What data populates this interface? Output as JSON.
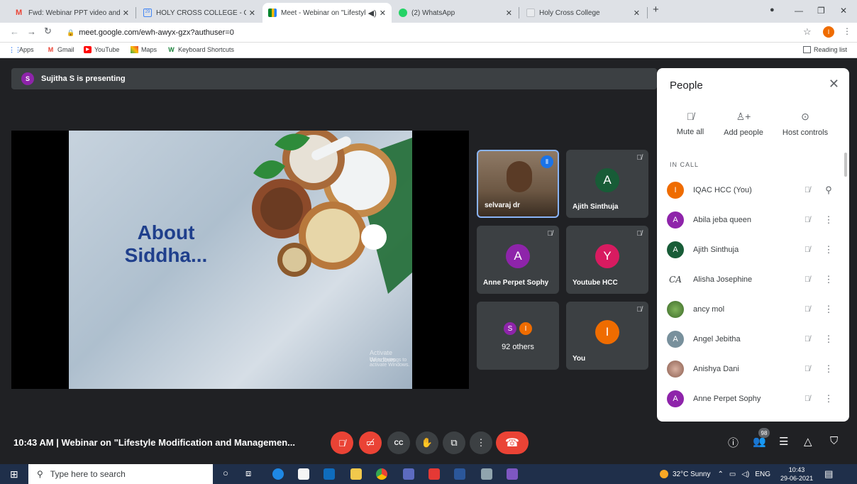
{
  "browser": {
    "tabs": [
      {
        "title": "Fwd: Webinar PPT video and Pra",
        "icon": "gmail-icon",
        "color": "#ea4335"
      },
      {
        "title": "HOLY CROSS COLLEGE - Calenda",
        "icon": "calendar-icon",
        "color": "#4285f4"
      },
      {
        "title": "Meet - Webinar on \"Lifestyle",
        "icon": "meet-icon",
        "color": "#00832d"
      },
      {
        "title": "(2) WhatsApp",
        "icon": "whatsapp-icon",
        "color": "#25d366"
      },
      {
        "title": "Holy Cross College",
        "icon": "page-icon",
        "color": "#bdc1c6"
      }
    ],
    "url": "meet.google.com/ewh-awyx-gzx?authuser=0",
    "bookmarks": [
      "Apps",
      "Gmail",
      "YouTube",
      "Maps",
      "Keyboard Shortcuts"
    ],
    "reading_list": "Reading list",
    "profile_initial": "I"
  },
  "meet": {
    "presenting": "Sujitha S is presenting",
    "presenter_initial": "S",
    "slide_title": "About Siddha...",
    "watermark_1": "Activate Windows",
    "watermark_2": "Go to Settings to activate Windows.",
    "tiles": [
      {
        "name": "selvaraj dr",
        "initial": "",
        "color": "#8a6a4a"
      },
      {
        "name": "Ajith Sinthuja",
        "initial": "A",
        "color": "#185c37"
      },
      {
        "name": "Anne Perpet Sophy",
        "initial": "A",
        "color": "#8e24aa"
      },
      {
        "name": "Youtube HCC",
        "initial": "Y",
        "color": "#d81b60"
      },
      {
        "name": "92 others",
        "initial": "S",
        "initial2": "I",
        "color": "#8e24aa",
        "color2": "#ef6c00"
      },
      {
        "name": "You",
        "initial": "I",
        "color": "#ef6c00"
      }
    ],
    "meeting_info": "10:43 AM  |  Webinar on \"Lifestyle Modification and Managemen...",
    "participant_count": "98"
  },
  "people": {
    "title": "People",
    "actions": [
      "Mute all",
      "Add people",
      "Host controls"
    ],
    "section": "IN CALL",
    "list": [
      {
        "name": "IQAC HCC (You)",
        "initial": "I",
        "color": "#ef6c00"
      },
      {
        "name": "Abila jeba queen",
        "initial": "A",
        "color": "#8e24aa"
      },
      {
        "name": "Ajith Sinthuja",
        "initial": "A",
        "color": "#185c37"
      },
      {
        "name": "Alisha Josephine",
        "initial": "CA",
        "color": "#ffffff"
      },
      {
        "name": "ancy mol",
        "initial": "",
        "color": "#4e7d3a"
      },
      {
        "name": "Angel Jebitha",
        "initial": "A",
        "color": "#78909c"
      },
      {
        "name": "Anishya Dani",
        "initial": "",
        "color": "#b08a7a"
      },
      {
        "name": "Anne Perpet Sophy",
        "initial": "A",
        "color": "#8e24aa"
      }
    ]
  },
  "taskbar": {
    "search_placeholder": "Type here to search",
    "weather": "32°C  Sunny",
    "lang": "ENG",
    "time": "10:43",
    "date": "29-06-2021"
  }
}
